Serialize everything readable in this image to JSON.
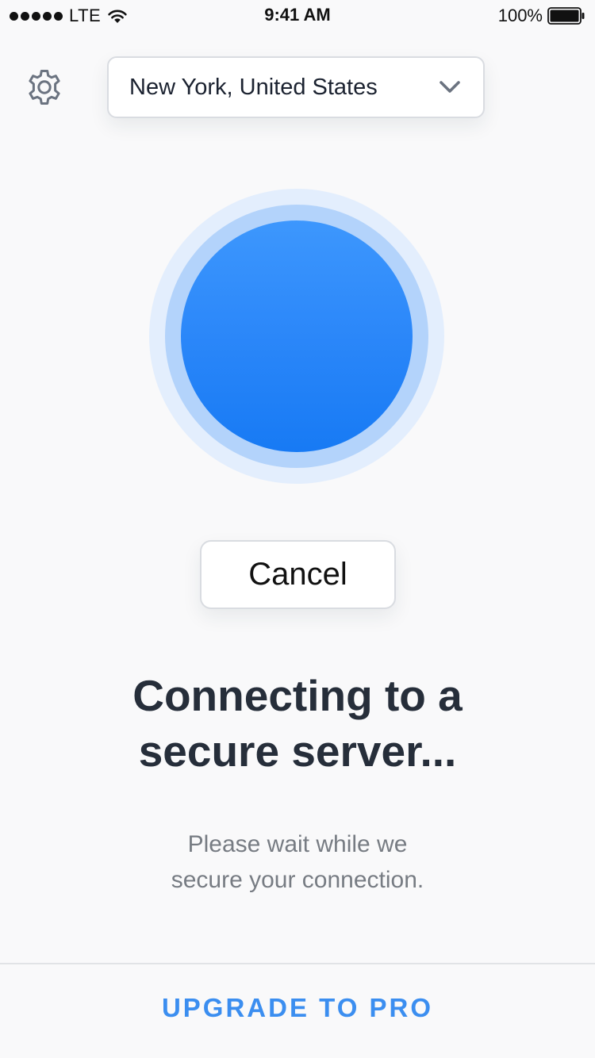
{
  "status_bar": {
    "carrier": "LTE",
    "time": "9:41 AM",
    "battery": "100%"
  },
  "location": {
    "selected": "New York, United States"
  },
  "connection": {
    "cancel_label": "Cancel",
    "headline_line1": "Connecting to a",
    "headline_line2": "secure server...",
    "subtext_line1": "Please wait while we",
    "subtext_line2": "secure your connection."
  },
  "footer": {
    "upgrade_label": "UPGRADE TO PRO"
  },
  "colors": {
    "accent": "#3b8ef0",
    "orb_core": "#2b87f9",
    "orb_ring": "#b3d3fb",
    "orb_halo": "#e3eefd"
  },
  "icons": {
    "settings": "gear-icon",
    "dropdown": "chevron-down-icon",
    "wifi": "wifi-icon",
    "battery": "battery-icon"
  }
}
